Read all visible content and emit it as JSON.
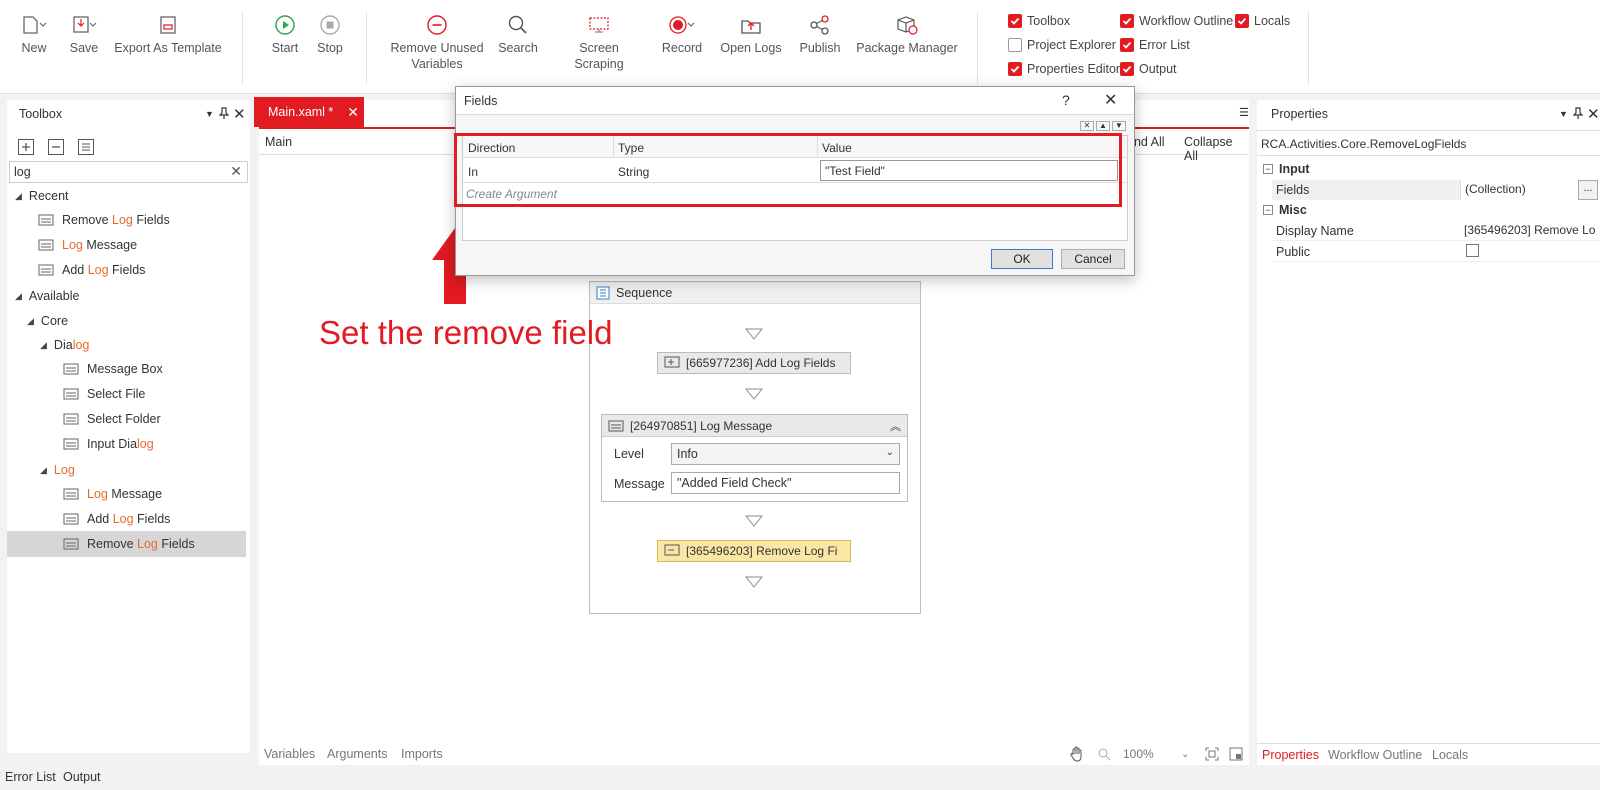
{
  "colors": {
    "accent": "#e21a22",
    "highlight": "#e86a2c",
    "selected_row": "#d6d6d6",
    "yellow_activity": "#fbe7a5"
  },
  "ribbon": {
    "buttons": [
      {
        "label": "New",
        "icon": "new-file-icon"
      },
      {
        "label": "Save",
        "icon": "save-icon"
      },
      {
        "label": "Export As Template",
        "icon": "export-template-icon"
      },
      {
        "label": "Start",
        "icon": "play-icon"
      },
      {
        "label": "Stop",
        "icon": "stop-icon"
      },
      {
        "label": "Remove Unused Variables",
        "icon": "remove-circle-icon"
      },
      {
        "label": "Search",
        "icon": "search-icon"
      },
      {
        "label": "Screen Scraping",
        "icon": "screen-scraping-icon"
      },
      {
        "label": "Record",
        "icon": "record-icon"
      },
      {
        "label": "Open Logs",
        "icon": "open-logs-icon"
      },
      {
        "label": "Publish",
        "icon": "publish-icon"
      },
      {
        "label": "Package Manager",
        "icon": "package-icon"
      }
    ],
    "remove_unused_line1": "Remove Unused",
    "remove_unused_line2": "Variables",
    "checkboxes": {
      "toolbox": {
        "label": "Toolbox",
        "checked": true
      },
      "workflow_outline": {
        "label": "Workflow Outline",
        "checked": true
      },
      "locals": {
        "label": "Locals",
        "checked": true
      },
      "project_explorer": {
        "label": "Project Explorer",
        "checked": false
      },
      "error_list": {
        "label": "Error List",
        "checked": true
      },
      "properties_editor": {
        "label": "Properties Editor",
        "checked": true
      },
      "output": {
        "label": "Output",
        "checked": true
      }
    }
  },
  "toolbox": {
    "title": "Toolbox",
    "search_value": "log",
    "recent_label": "Recent",
    "recent": [
      {
        "pre": "Remove ",
        "hl": "Log",
        "post": " Fields"
      },
      {
        "pre": "",
        "hl": "Log",
        "post": " Message"
      },
      {
        "pre": "Add ",
        "hl": "Log",
        "post": " Fields"
      }
    ],
    "available_label": "Available",
    "core_label": "Core",
    "dialog_group": {
      "pre": "Dia",
      "hl": "log"
    },
    "dialog_items": [
      {
        "pre": "Message Box",
        "hl": "",
        "post": ""
      },
      {
        "pre": "Select File",
        "hl": "",
        "post": ""
      },
      {
        "pre": "Select Folder",
        "hl": "",
        "post": ""
      },
      {
        "pre": "Input Dia",
        "hl": "log",
        "post": ""
      }
    ],
    "log_group": {
      "pre": "",
      "hl": "Log"
    },
    "log_items": [
      {
        "pre": "",
        "hl": "Log",
        "post": " Message"
      },
      {
        "pre": "Add ",
        "hl": "Log",
        "post": " Fields"
      },
      {
        "pre": "Remove ",
        "hl": "Log",
        "post": " Fields"
      }
    ]
  },
  "editor": {
    "tab_label": "Main.xaml *",
    "breadcrumb": "Main",
    "expand_all": "Expand All",
    "expand_all_visible": "and All",
    "collapse_all": "Collapse All",
    "sequence_title": "Sequence",
    "add_log_fields": "[665977236] Add Log Fields",
    "log_message_title": "[264970851] Log Message",
    "level_label": "Level",
    "level_value": "Info",
    "message_label": "Message",
    "message_value": "\"Added Field Check\"",
    "remove_log_fields": "[365496203] Remove Log Fi",
    "bottom_tabs": [
      "Variables",
      "Arguments",
      "Imports"
    ],
    "zoom": "100%"
  },
  "annotation": {
    "text": "Set the remove field"
  },
  "dialog": {
    "title": "Fields",
    "help": "?",
    "columns": [
      "Direction",
      "Type",
      "Value"
    ],
    "row": {
      "direction": "In",
      "type": "String",
      "value": "\"Test Field\""
    },
    "create_argument": "Create Argument",
    "ok": "OK",
    "cancel": "Cancel"
  },
  "properties": {
    "title": "Properties",
    "class_name": "RCA.Activities.Core.RemoveLogFields",
    "input_section": "Input",
    "fields_label": "Fields",
    "fields_value": "(Collection)",
    "ellipsis": "...",
    "misc_section": "Misc",
    "display_name_label": "Display Name",
    "display_name_value": "[365496203] Remove Lo",
    "public_label": "Public",
    "bottom_tabs": [
      "Properties",
      "Workflow Outline",
      "Locals"
    ]
  },
  "bottom_bar": {
    "tabs": [
      "Error List",
      "Output"
    ]
  }
}
